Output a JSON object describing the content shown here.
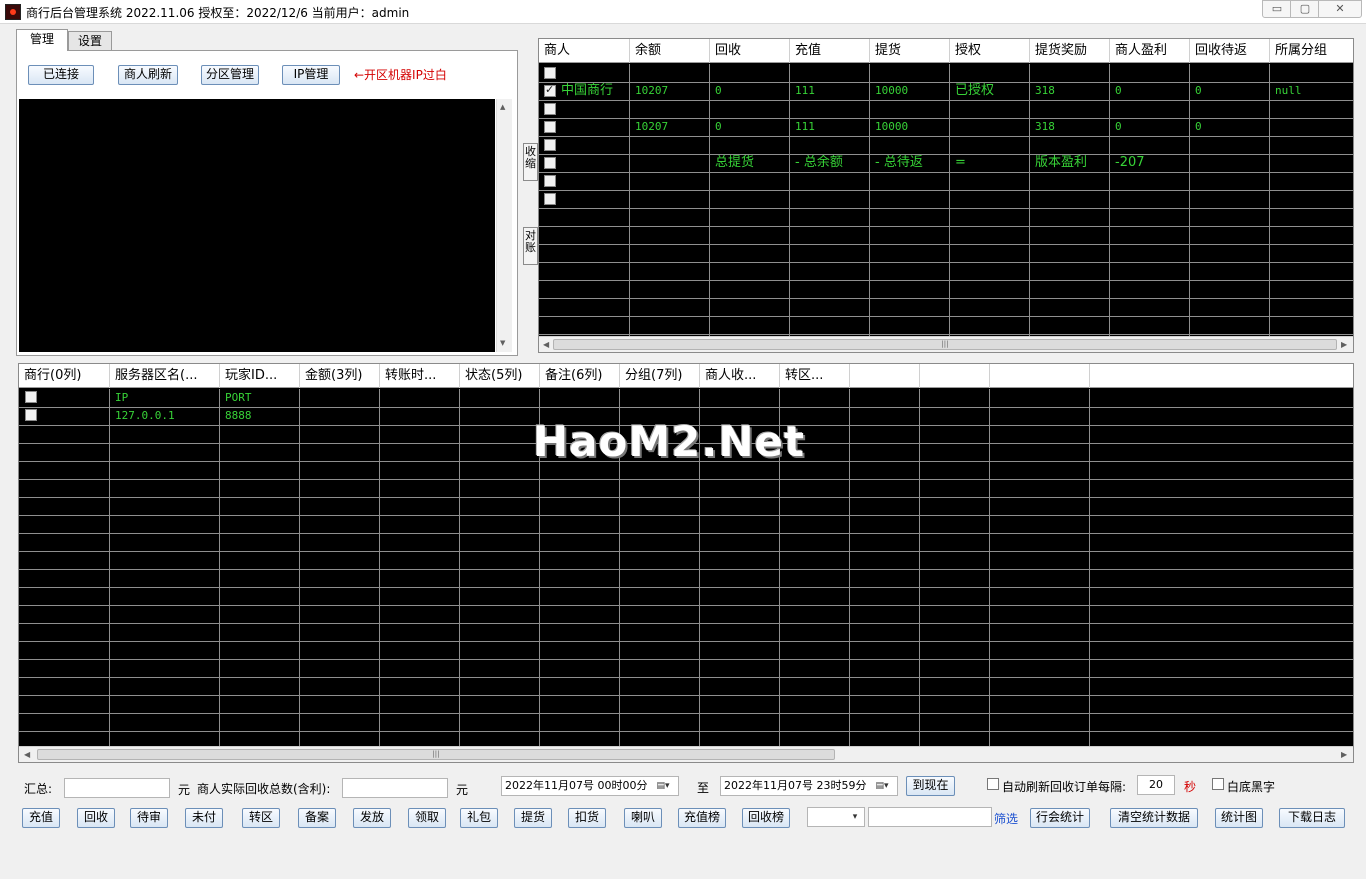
{
  "window": {
    "title": "商行后台管理系统 2022.11.06   授权至：2022/12/6 当前用户：admin",
    "min": "▭",
    "max": "▢",
    "close": "✕"
  },
  "tabs": [
    {
      "label": "管理",
      "active": true
    },
    {
      "label": "设置",
      "active": false
    }
  ],
  "manage": {
    "buttons": [
      "已连接",
      "商人刷新",
      "分区管理",
      "IP管理"
    ],
    "hint": "←开区机器IP过白"
  },
  "side_buttons": [
    "收缩",
    "对账"
  ],
  "merchant_grid": {
    "columns": [
      "商人",
      "余额",
      "回收",
      "充值",
      "提货",
      "授权",
      "提货奖励",
      "商人盈利",
      "回收待返",
      "所属分组"
    ],
    "rows": [
      {
        "checked": false,
        "cells": [
          "",
          "",
          "",
          "",
          "",
          "",
          "",
          "",
          "",
          ""
        ]
      },
      {
        "checked": true,
        "cells": [
          "中国商行",
          "10207",
          "0",
          "111",
          "10000",
          "已授权",
          "318",
          "0",
          "0",
          "null"
        ]
      },
      {
        "checked": false,
        "cells": [
          "",
          "",
          "",
          "",
          "",
          "",
          "",
          "",
          "",
          ""
        ]
      },
      {
        "checked": false,
        "cells": [
          "",
          "10207",
          "0",
          "111",
          "10000",
          "",
          "318",
          "0",
          "0",
          ""
        ]
      },
      {
        "checked": false,
        "cells": [
          "",
          "",
          "",
          "",
          "",
          "",
          "",
          "",
          "",
          ""
        ]
      },
      {
        "checked": false,
        "cells": [
          "",
          "",
          "总提货",
          "- 总余额",
          "- 总待返",
          "=",
          "版本盈利",
          "-207",
          "",
          ""
        ]
      },
      {
        "checked": false,
        "cells": [
          "",
          "",
          "",
          "",
          "",
          "",
          "",
          "",
          "",
          ""
        ]
      },
      {
        "checked": false,
        "cells": [
          "",
          "",
          "",
          "",
          "",
          "",
          "",
          "",
          "",
          ""
        ]
      }
    ]
  },
  "transfer_grid": {
    "columns": [
      "商行(0列)",
      "服务器区名(...",
      "玩家ID...",
      "金额(3列)",
      "转账时...",
      "状态(5列)",
      "备注(6列)",
      "分组(7列)",
      "商人收...",
      "转区...",
      "",
      "",
      ""
    ],
    "rows": [
      {
        "checked": false,
        "cells": [
          "",
          "IP",
          "PORT"
        ]
      },
      {
        "checked": false,
        "cells": [
          "",
          "127.0.0.1",
          "8888"
        ]
      }
    ]
  },
  "watermark": "HaoM2.Net",
  "bottom": {
    "summary_label": "汇总:",
    "summary_value": "",
    "unit1": "元",
    "actual_label": "商人实际回收总数(含利):",
    "actual_value": "",
    "unit2": "元",
    "date_from": "2022年11月07号  00时00分",
    "to_label": "至",
    "date_to": "2022年11月07号  23时59分",
    "now_button": "到现在",
    "auto_refresh_label": "自动刷新回收订单每隔:",
    "auto_refresh_value": "20",
    "seconds": "秒",
    "white_black_label": "白底黑字",
    "action_buttons": [
      "充值",
      "回收",
      "待审",
      "未付",
      "转区",
      "备案",
      "发放",
      "领取",
      "礼包",
      "提货",
      "扣货",
      "喇叭",
      "充值榜",
      "回收榜"
    ],
    "filter_select": "",
    "filter_input": "",
    "filter_label": "筛选",
    "right_buttons": [
      "行会统计",
      "清空统计数据",
      "统计图",
      "下载日志"
    ]
  },
  "icons": {
    "dropdown": "chevron-down-icon",
    "calendar": "calendar-icon",
    "scroll_up": "arrow-up-icon",
    "scroll_down": "arrow-down-icon",
    "scroll_left": "arrow-left-icon",
    "scroll_right": "arrow-right-icon"
  },
  "colors": {
    "grid_bg": "#000000",
    "grid_text": "#37d237",
    "hint": "#d40000"
  }
}
